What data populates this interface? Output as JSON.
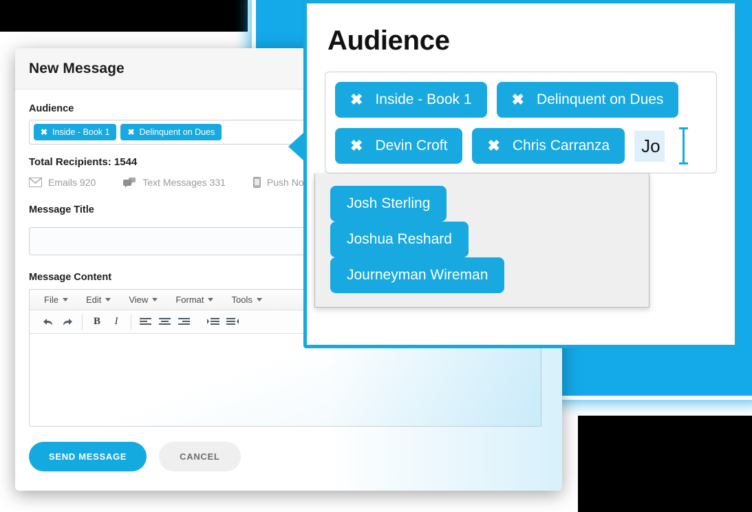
{
  "background": {
    "accent_blue": "#14a9e8",
    "chip_blue": "#17a9e0"
  },
  "message_card": {
    "header_title": "New Message",
    "audience": {
      "label": "Audience",
      "chips": [
        {
          "label": "Inside - Book 1",
          "remove_icon": "close-icon"
        },
        {
          "label": "Delinquent on Dues",
          "remove_icon": "close-icon"
        }
      ]
    },
    "total_recipients": "Total Recipients: 1544",
    "stats": [
      {
        "icon": "envelope-icon",
        "label": "Emails 920"
      },
      {
        "icon": "chat-bubbles-icon",
        "label": "Text Messages 331"
      },
      {
        "icon": "mobile-phone-icon",
        "label": "Push Notifica"
      }
    ],
    "message_title": {
      "label": "Message Title",
      "value": "",
      "placeholder": ""
    },
    "message_content": {
      "label": "Message Content",
      "value": "",
      "menubar": [
        {
          "label": "File"
        },
        {
          "label": "Edit"
        },
        {
          "label": "View"
        },
        {
          "label": "Format"
        },
        {
          "label": "Tools"
        }
      ],
      "toolbar": [
        {
          "icon": "undo-icon"
        },
        {
          "icon": "redo-icon"
        },
        {
          "icon": "bold-icon",
          "glyph": "B"
        },
        {
          "icon": "italic-icon",
          "glyph": "I"
        },
        {
          "icon": "align-left-icon"
        },
        {
          "icon": "align-center-icon"
        },
        {
          "icon": "align-right-icon"
        },
        {
          "icon": "indent-icon"
        },
        {
          "icon": "outdent-icon"
        }
      ]
    },
    "actions": {
      "send_label": "SEND MESSAGE",
      "cancel_label": "CANCEL"
    }
  },
  "callout": {
    "title": "Audience",
    "chips": [
      {
        "label": "Inside - Book 1",
        "remove_icon": "close-icon"
      },
      {
        "label": "Delinquent on Dues",
        "remove_icon": "close-icon"
      },
      {
        "label": "Devin Croft",
        "remove_icon": "close-icon"
      },
      {
        "label": "Chris Carranza",
        "remove_icon": "close-icon"
      }
    ],
    "typed_text": "Jo",
    "suggestions": [
      {
        "label": "Josh Sterling"
      },
      {
        "label": "Joshua Reshard"
      },
      {
        "label": "Journeyman Wireman"
      }
    ]
  }
}
